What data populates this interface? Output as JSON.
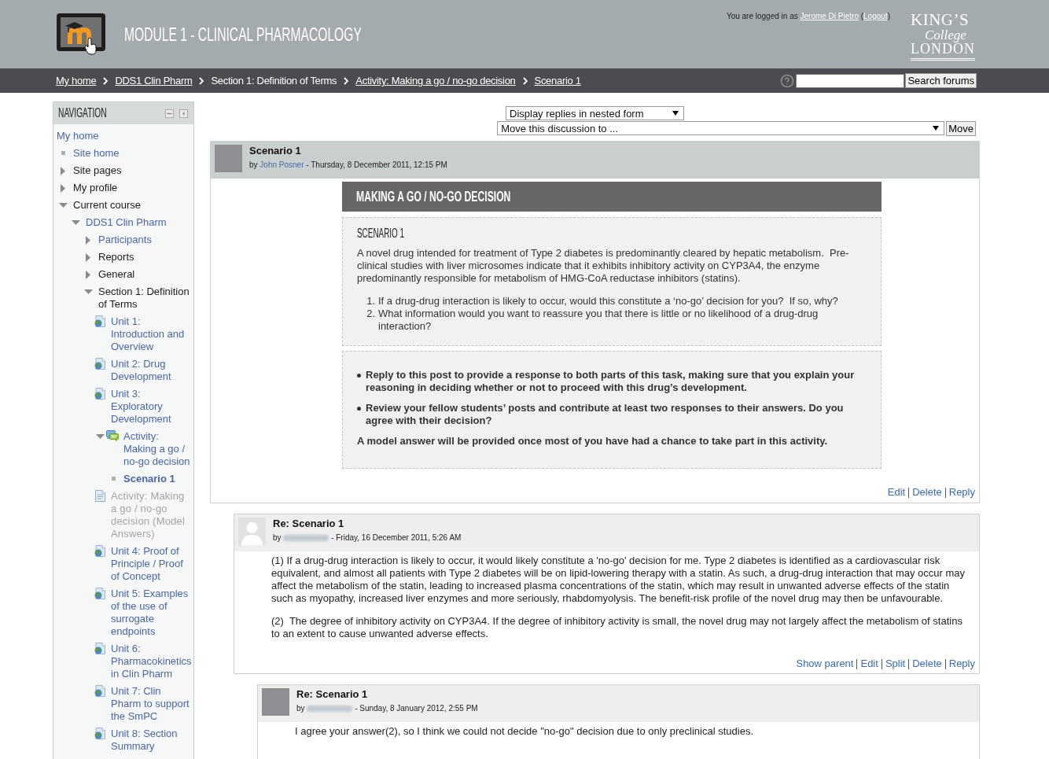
{
  "header": {
    "title": "MODULE 1 - CLINICAL PHARMACOLOGY",
    "login": [
      {
        "text": "You are logged in as ",
        "kind": "text"
      },
      {
        "text": "Jerome Di Pietro",
        "kind": "user"
      },
      {
        "text": " (",
        "kind": "text"
      },
      {
        "text": "Logout",
        "kind": "logout"
      },
      {
        "text": ")",
        "kind": "text"
      }
    ],
    "logo": [
      "KING’S",
      "College",
      "LONDON"
    ]
  },
  "breadcrumb": {
    "items": [
      {
        "label": "My home",
        "kind": "link"
      },
      {
        "label": "DDS1 Clin Pharm",
        "kind": "link"
      },
      {
        "label": "Section 1: Definition of Terms",
        "kind": "text"
      },
      {
        "label": "Activity: Making a go / no-go decision",
        "kind": "link"
      },
      {
        "label": "Scenario 1",
        "kind": "link"
      }
    ],
    "search_button": "Search forums"
  },
  "navigation": {
    "title": "NAVIGATION",
    "tree": [
      {
        "label": "My home",
        "kind": "root",
        "link": true,
        "dimmed": false,
        "selected": false,
        "children": [
          {
            "label": "Site home",
            "kind": "leaf",
            "link": true,
            "dimmed": false,
            "selected": false
          },
          {
            "label": "Site pages",
            "kind": "branch",
            "link": false,
            "dimmed": false,
            "selected": false,
            "expanded": false
          },
          {
            "label": "My profile",
            "kind": "branch",
            "link": false,
            "dimmed": false,
            "selected": false,
            "expanded": false
          },
          {
            "label": "Current course",
            "kind": "branch",
            "link": false,
            "dimmed": false,
            "selected": false,
            "expanded": true,
            "children": [
              {
                "label": "DDS1 Clin Pharm",
                "kind": "branch",
                "link": true,
                "dimmed": false,
                "selected": false,
                "expanded": true,
                "children": [
                  {
                    "label": "Participants",
                    "kind": "branch",
                    "link": true,
                    "dimmed": false,
                    "selected": false,
                    "expanded": false
                  },
                  {
                    "label": "Reports",
                    "kind": "branch",
                    "link": false,
                    "dimmed": false,
                    "selected": false,
                    "expanded": false
                  },
                  {
                    "label": "General",
                    "kind": "branch",
                    "link": false,
                    "dimmed": false,
                    "selected": false,
                    "expanded": false
                  },
                  {
                    "label": "Section 1: Definition of Terms",
                    "kind": "branch",
                    "link": false,
                    "dimmed": false,
                    "selected": false,
                    "expanded": true,
                    "children": [
                      {
                        "label": "Unit 1: Introduction and Overview",
                        "kind": "url",
                        "link": true,
                        "dimmed": false,
                        "selected": false
                      },
                      {
                        "label": "Unit 2: Drug Development",
                        "kind": "url",
                        "link": true,
                        "dimmed": false,
                        "selected": false
                      },
                      {
                        "label": "Unit 3: Exploratory Development",
                        "kind": "url",
                        "link": true,
                        "dimmed": false,
                        "selected": false
                      },
                      {
                        "label": "Activity: Making a go / no-go decision",
                        "kind": "forum",
                        "link": true,
                        "dimmed": false,
                        "selected": false,
                        "expanded": true,
                        "children": [
                          {
                            "label": "Scenario 1",
                            "kind": "leaf",
                            "link": true,
                            "dimmed": false,
                            "selected": true
                          }
                        ]
                      },
                      {
                        "label": "Activity: Making a go / no-go decision (Model Answers)",
                        "kind": "page",
                        "link": true,
                        "dimmed": true,
                        "selected": false
                      },
                      {
                        "label": "Unit 4: Proof of Principle / Proof of Concept",
                        "kind": "url",
                        "link": true,
                        "dimmed": false,
                        "selected": false
                      },
                      {
                        "label": "Unit 5: Examples of the use of surrogate endpoints",
                        "kind": "url",
                        "link": true,
                        "dimmed": false,
                        "selected": false
                      },
                      {
                        "label": "Unit 6: Pharmacokinetics in Clin Pharm",
                        "kind": "url",
                        "link": true,
                        "dimmed": false,
                        "selected": false
                      },
                      {
                        "label": "Unit 7: Clin Pharm to support the SmPC",
                        "kind": "url",
                        "link": true,
                        "dimmed": false,
                        "selected": false
                      },
                      {
                        "label": "Unit 8: Section Summary",
                        "kind": "url",
                        "link": true,
                        "dimmed": false,
                        "selected": false
                      }
                    ]
                  }
                ]
              }
            ]
          }
        ]
      }
    ]
  },
  "forum_controls": {
    "display_mode": "Display replies in nested form",
    "move_to": "Move this discussion to ...",
    "move_button": "Move"
  },
  "discussion": {
    "kind": "discussion",
    "avatar": {
      "kind": "photo"
    },
    "subject": "Scenario 1",
    "by": "by",
    "author": "John Posner",
    "author_hidden": false,
    "date": "- Thursday, 8 December 2011, 12:15 PM",
    "content": {
      "banner": "MAKING A GO / NO-GO DECISION",
      "heading": "SCENARIO 1",
      "text": "A novel drug intended for treatment of Type 2 diabetes is predominantly cleared by hepatic metabolism.  Pre-clinical studies with liver microsomes indicate that it exhibits inhibitory activity on CYP3A4, the enzyme predominantly responsible for metabolism of HMG-CoA reductase inhibitors (statins).",
      "questions": [
        {
          "number": "1.",
          "text": "If a drug-drug interaction is likely to occur, would this constitute a ‘no-go’ decision for you?  If so, why?"
        },
        {
          "number": "2.",
          "text": "What information would you want to reassure you that there is little or no likelihood of a drug-drug interaction?"
        }
      ],
      "tasks": [
        "Reply to this post to provide a response to both parts of this task, making sure that you explain your reasoning in deciding whether or not to proceed with this drug’s development.",
        "Review your fellow students’ posts and contribute at least two responses to their answers. Do you agree with their decision?"
      ],
      "note": "A model answer will be provided once most of you have had a chance to take part in this activity."
    },
    "commands": [
      "Edit",
      "Delete",
      "Reply"
    ],
    "replies": [
      {
        "kind": "reply",
        "avatar": {
          "kind": "default"
        },
        "subject": "Re: Scenario 1",
        "by": "by",
        "author_hidden": true,
        "date": "- Friday, 16 December 2011, 5:26 AM",
        "paragraphs": [
          "(1) If a drug-drug interaction is likely to occur, it would likely constitute a 'no-go' decision for me. Type 2 diabetes is identified as a cardiovascular risk equivalent, and almost all patients with Type 2 diabetes will be on lipid-lowering therapy with a statin. As such, a drug-drug interaction that may occur may affect the metabolism of the statin, leading to increased plasma concentrations of the statin, which may result in unwanted adverse effects of the statin such as myopathy, increased liver enzymes and more seriously, rhabdomyolysis. The benefit-risk profile of the novel drug may then be unfavourable.",
          "(2)  The degree of inhibitory activity on CYP3A4. If the degree of inhibitory activity is small, the novel drug may not largely affect the metabolism of statins to an extent to cause unwanted adverse effects."
        ],
        "commands": [
          "Show parent",
          "Edit",
          "Split",
          "Delete",
          "Reply"
        ],
        "replies": [
          {
            "kind": "reply",
            "avatar": {
              "kind": "photo"
            },
            "subject": "Re: Scenario 1",
            "by": "by",
            "author_hidden": true,
            "date": "- Sunday, 8 January 2012, 2:55 PM",
            "paragraphs": [
              "I agree your answer(2), so I think we could not decide \"no-go\" decision due to only preclinical studies."
            ]
          }
        ]
      }
    ]
  }
}
